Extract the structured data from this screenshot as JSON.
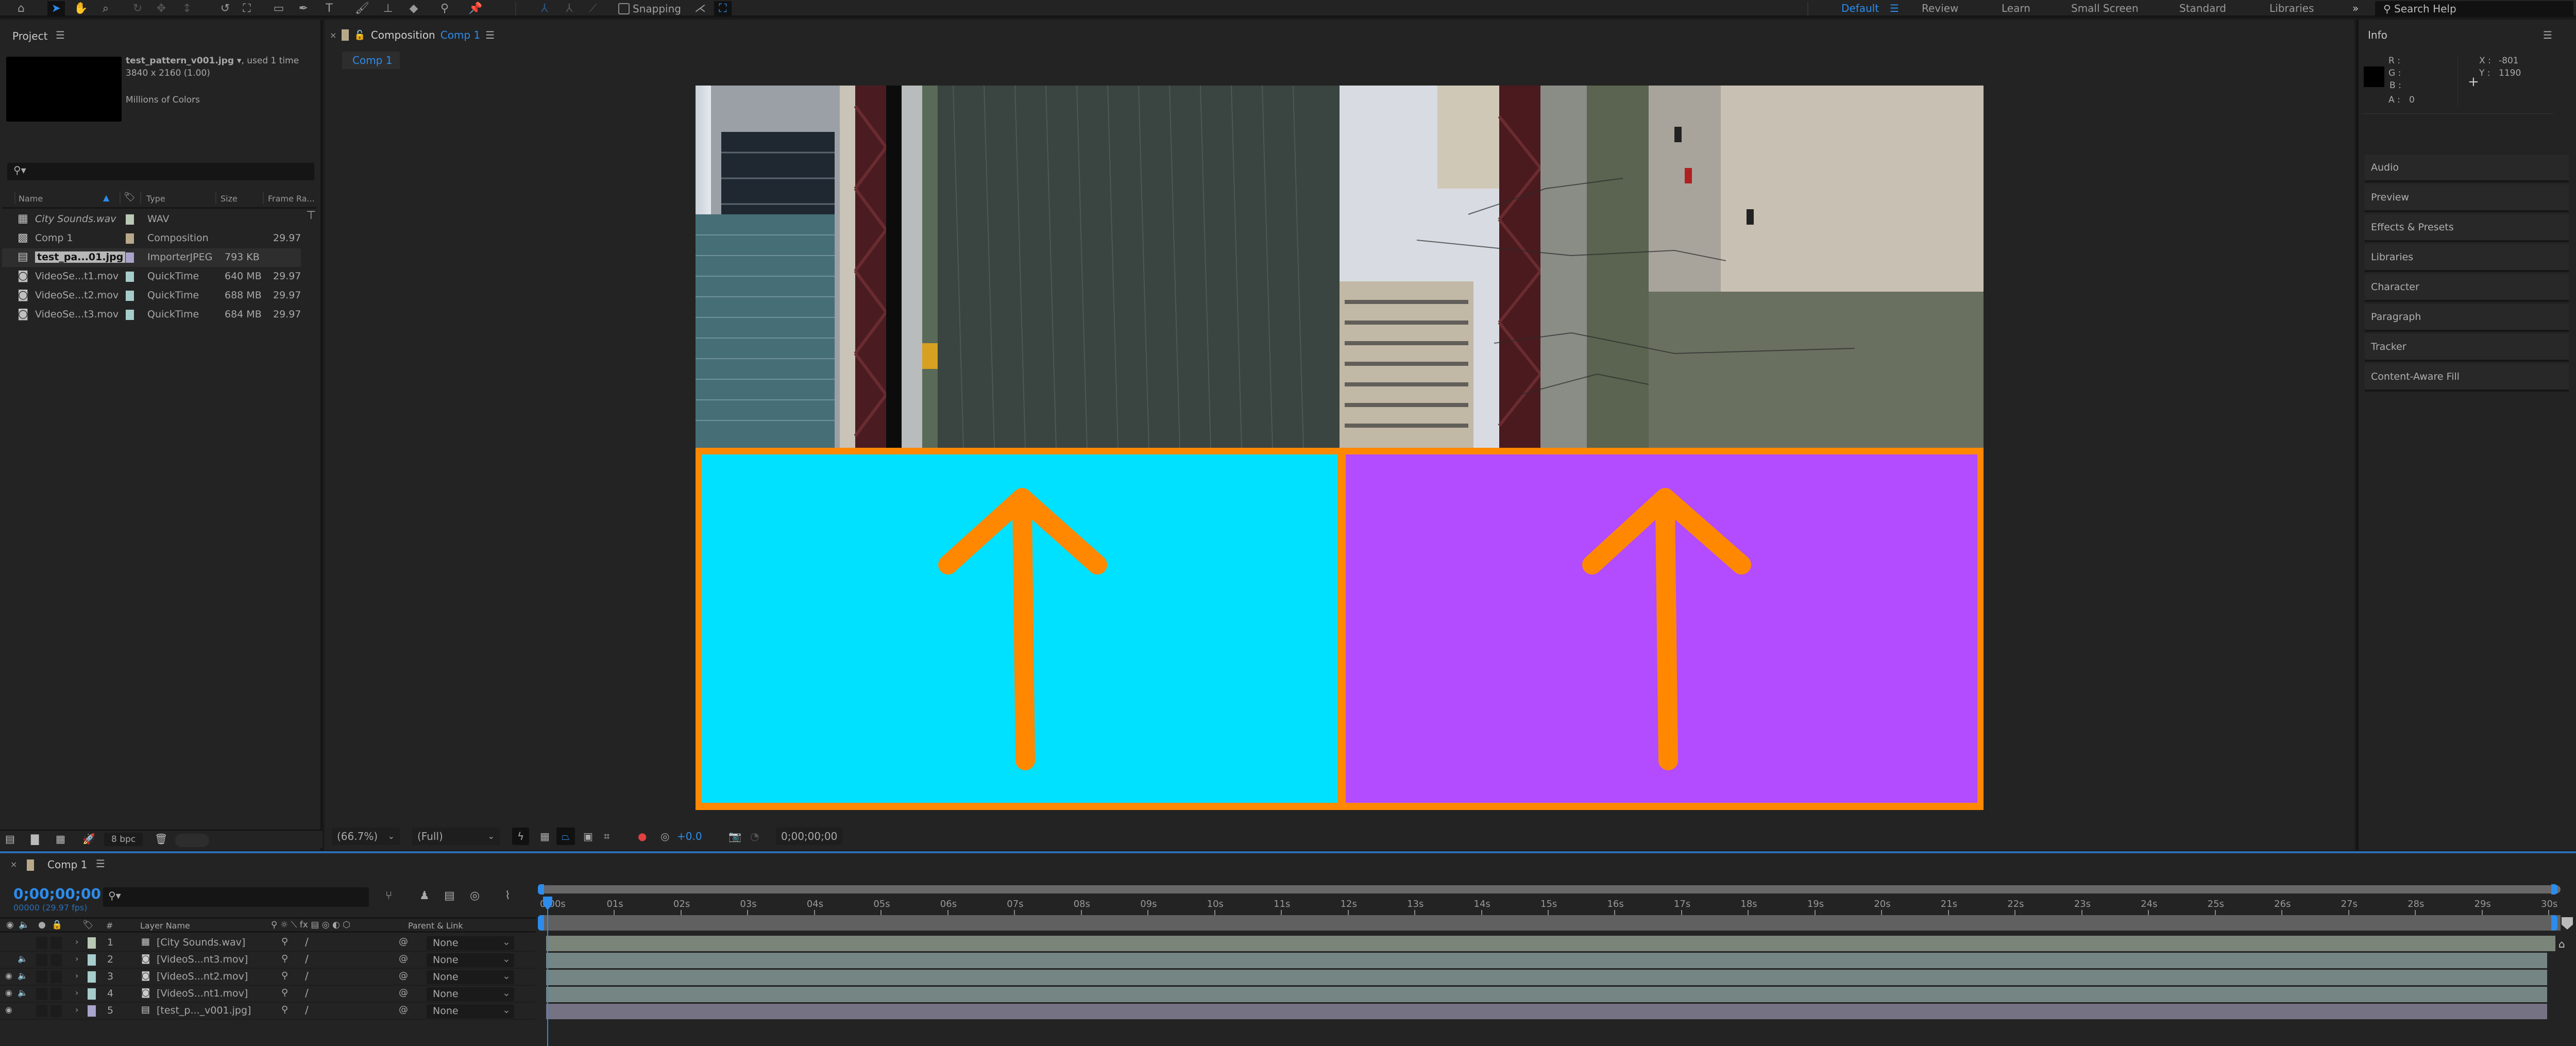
{
  "toolbar": {
    "snapping_label": "Snapping",
    "workspaces": [
      {
        "label": "Default",
        "active": true
      },
      {
        "label": "Review",
        "active": false
      },
      {
        "label": "Learn",
        "active": false
      },
      {
        "label": "Small Screen",
        "active": false
      },
      {
        "label": "Standard",
        "active": false
      },
      {
        "label": "Libraries",
        "active": false
      }
    ],
    "overflow_label": "»",
    "search_help_placeholder": "Search Help"
  },
  "project": {
    "title": "Project",
    "selected_name": "test_pattern_v001.jpg ▾",
    "selected_used": ", used 1 time",
    "selected_dims": "3840 x 2160 (1.00)",
    "selected_colors": "Millions of Colors",
    "columns": {
      "name": "Name",
      "type": "Type",
      "size": "Size",
      "frame_rate": "Frame Ra..."
    },
    "items": [
      {
        "name": "City Sounds.wav",
        "type": "WAV",
        "size": "",
        "fps": "",
        "label_color": "#b8c8b4",
        "icon": "audio-file-icon",
        "italic": true
      },
      {
        "name": "Comp 1",
        "type": "Composition",
        "size": "",
        "fps": "29.97",
        "label_color": "#b8a98a",
        "icon": "composition-icon",
        "italic": false
      },
      {
        "name": "test_pa...01.jpg",
        "type": "ImporterJPEG",
        "size": "793 KB",
        "fps": "",
        "label_color": "#a8a4cc",
        "icon": "image-file-icon",
        "italic": false,
        "selected": true
      },
      {
        "name": "VideoSe...t1.mov",
        "type": "QuickTime",
        "size": "640 MB",
        "fps": "29.97",
        "label_color": "#a6cccb",
        "icon": "video-file-icon",
        "italic": false
      },
      {
        "name": "VideoSe...t2.mov",
        "type": "QuickTime",
        "size": "688 MB",
        "fps": "29.97",
        "label_color": "#a6cccb",
        "icon": "video-file-icon",
        "italic": false
      },
      {
        "name": "VideoSe...t3.mov",
        "type": "QuickTime",
        "size": "684 MB",
        "fps": "29.97",
        "label_color": "#a6cccb",
        "icon": "video-file-icon",
        "italic": false
      }
    ],
    "bpc_label": "8 bpc"
  },
  "composition": {
    "tab_prefix": "Composition",
    "tab_name": "Comp 1",
    "subtab": "Comp 1",
    "magnification": "(66.7%)",
    "resolution": "(Full)",
    "exposure": "+0.0",
    "timecode": "0;00;00;00",
    "test_pattern": {
      "left_color": "#00e0ff",
      "right_color": "#b34bff",
      "border_color": "#ff8800"
    }
  },
  "info": {
    "title": "Info",
    "r_label": "R :",
    "g_label": "G :",
    "b_label": "B :",
    "a_label": "A :",
    "a_value": "0",
    "x_label": "X :",
    "x_value": "-801",
    "y_label": "Y :",
    "y_value": "1190"
  },
  "right_panels": [
    "Audio",
    "Preview",
    "Effects & Presets",
    "Libraries",
    "Character",
    "Paragraph",
    "Tracker",
    "Content-Aware Fill"
  ],
  "timeline": {
    "tab_name": "Comp 1",
    "timecode": "0;00;00;00",
    "frame_fps": "00000 (29.97 fps)",
    "headers": {
      "number": "#",
      "layer_name": "Layer Name",
      "parent": "Parent & Link"
    },
    "ruler_ticks": [
      "0:00s",
      "01s",
      "02s",
      "03s",
      "04s",
      "05s",
      "06s",
      "07s",
      "08s",
      "09s",
      "10s",
      "11s",
      "12s",
      "13s",
      "14s",
      "15s",
      "16s",
      "17s",
      "18s",
      "19s",
      "20s",
      "21s",
      "22s",
      "23s",
      "24s",
      "25s",
      "26s",
      "27s",
      "28s",
      "29s",
      "30s"
    ],
    "layers": [
      {
        "num": "1",
        "name": "[City Sounds.wav]",
        "parent": "None",
        "label_color": "#b8c8b4",
        "bar_color": "#7a8478",
        "video": false,
        "audio": false,
        "icon": "audio-file-icon"
      },
      {
        "num": "2",
        "name": "[VideoS...nt3.mov]",
        "parent": "None",
        "label_color": "#a6cccb",
        "bar_color": "#748584",
        "video": false,
        "audio": true,
        "icon": "video-file-icon"
      },
      {
        "num": "3",
        "name": "[VideoS...nt2.mov]",
        "parent": "None",
        "label_color": "#a6cccb",
        "bar_color": "#748584",
        "video": true,
        "audio": true,
        "icon": "video-file-icon"
      },
      {
        "num": "4",
        "name": "[VideoS...nt1.mov]",
        "parent": "None",
        "label_color": "#a6cccb",
        "bar_color": "#748584",
        "video": true,
        "audio": true,
        "icon": "video-file-icon"
      },
      {
        "num": "5",
        "name": "[test_p..._v001.jpg]",
        "parent": "None",
        "label_color": "#a8a4cc",
        "bar_color": "#747283",
        "video": true,
        "audio": false,
        "icon": "image-file-icon"
      }
    ]
  }
}
